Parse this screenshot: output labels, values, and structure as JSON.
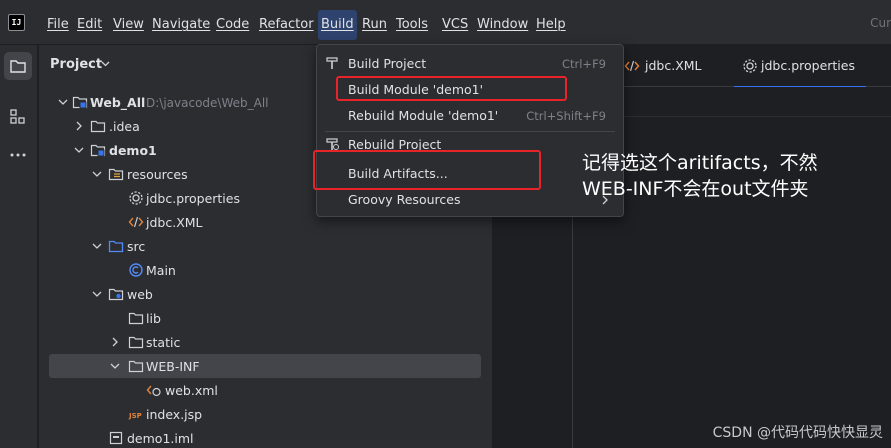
{
  "menubar": {
    "logo": "IJ",
    "items": [
      "File",
      "Edit",
      "View",
      "Navigate",
      "Code",
      "Refactor",
      "Build",
      "Run",
      "Tools",
      "VCS",
      "Window",
      "Help"
    ],
    "current_truncated": "Cur"
  },
  "project_panel": {
    "title": "Project",
    "tree": [
      {
        "label": "Web_All",
        "path": "D:\\javacode\\Web_All",
        "icon": "module-folder-icon",
        "expanded": true
      },
      {
        "label": ".idea",
        "icon": "folder-icon",
        "expanded": false
      },
      {
        "label": "demo1",
        "icon": "module-folder-icon",
        "expanded": true
      },
      {
        "label": "resources",
        "icon": "resources-folder-icon",
        "expanded": true
      },
      {
        "label": "jdbc.properties",
        "icon": "properties-file-icon"
      },
      {
        "label": "jdbc.XML",
        "icon": "xml-file-icon"
      },
      {
        "label": "src",
        "icon": "source-folder-icon",
        "expanded": true
      },
      {
        "label": "Main",
        "icon": "java-class-icon"
      },
      {
        "label": "web",
        "icon": "web-folder-icon",
        "expanded": true
      },
      {
        "label": "lib",
        "icon": "folder-icon"
      },
      {
        "label": "static",
        "icon": "folder-icon",
        "expanded": false
      },
      {
        "label": "WEB-INF",
        "icon": "folder-icon",
        "expanded": true,
        "selected": true
      },
      {
        "label": "web.xml",
        "icon": "web-xml-icon"
      },
      {
        "label": "index.jsp",
        "icon": "jsp-file-icon"
      },
      {
        "label": "demo1.iml",
        "icon": "iml-file-icon"
      }
    ]
  },
  "editor": {
    "tabs": [
      {
        "label": "jdbc.XML",
        "icon": "xml-file-icon"
      },
      {
        "label": "jdbc.properties",
        "icon": "gear-icon",
        "active": true
      }
    ]
  },
  "build_menu": {
    "items": [
      {
        "label": "Build Project",
        "shortcut": "Ctrl+F9",
        "icon": "build-hammer-icon"
      },
      {
        "label": "Build Module 'demo1'",
        "shortcut": ""
      },
      {
        "label": "Rebuild Module 'demo1'",
        "shortcut": "Ctrl+Shift+F9"
      },
      {
        "label": "Rebuild Project",
        "shortcut": "",
        "icon": "rebuild-icon"
      },
      {
        "label": "Build Artifacts...",
        "shortcut": ""
      },
      {
        "label": "Groovy Resources",
        "shortcut": "",
        "submenu": true
      }
    ]
  },
  "annotation": {
    "line1": "记得选这个aritifacts，不然",
    "line2": "WEB-INF不会在out文件夹"
  },
  "watermark": "CSDN @代码代码快快显灵",
  "colors": {
    "highlight_box": "#e8232a",
    "selection": "#43454a",
    "menu_active": "#2e436e",
    "accent": "#3574f0"
  }
}
